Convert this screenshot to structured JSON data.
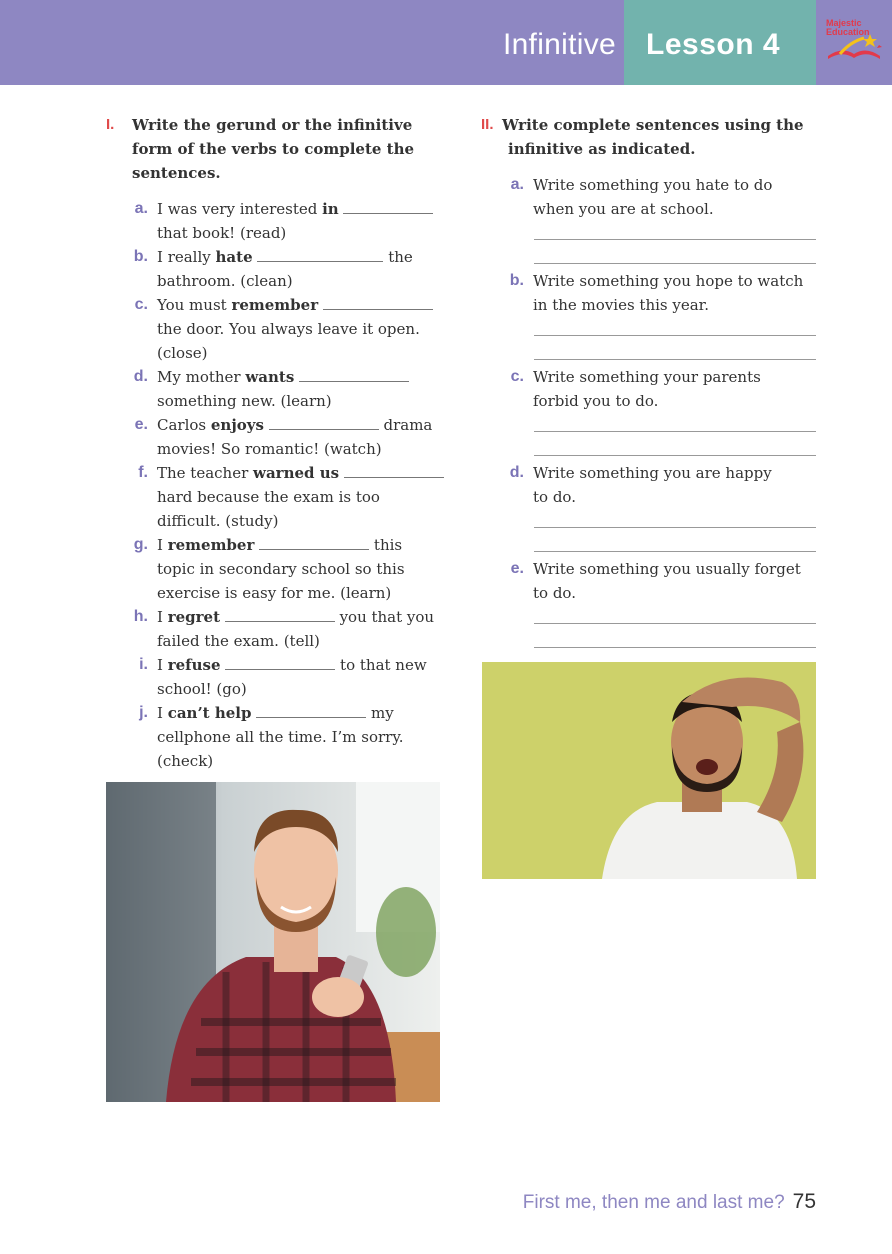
{
  "header": {
    "topic": "Infinitive",
    "lesson": "Lesson 4",
    "logo_text_1": "Majestic",
    "logo_text_2": "Education",
    "colors": {
      "band": "#8e87c2",
      "lesson_box": "#72b3ad",
      "accent_red": "#e04b4b",
      "letter": "#7b74b6"
    }
  },
  "exercise1": {
    "number": "I.",
    "title_1": "Write the gerund or the infinitive",
    "title_2": "form of the verbs to complete the",
    "title_3": "sentences.",
    "items": [
      {
        "letter": "a.",
        "pre": "I was very interested ",
        "bold": "in",
        "post": "",
        "l2": "that book! (read)"
      },
      {
        "letter": "b.",
        "pre": "I really ",
        "bold": "hate",
        "post": " the",
        "l2": "bathroom. (clean)"
      },
      {
        "letter": "c.",
        "pre": "You must ",
        "bold": "remember",
        "post": "",
        "l2": "the door. You always leave it open.",
        "l3": "(close)"
      },
      {
        "letter": "d.",
        "pre": "My mother ",
        "bold": "wants",
        "post": "",
        "l2": "something new. (learn)"
      },
      {
        "letter": "e.",
        "pre": "Carlos ",
        "bold": "enjoys",
        "post": " drama",
        "l2": "movies! So romantic! (watch)"
      },
      {
        "letter": "f.",
        "pre": "The teacher ",
        "bold": "warned us",
        "post": "",
        "l2": "hard because the exam is too",
        "l3": "difficult. (study)"
      },
      {
        "letter": "g.",
        "pre": "I ",
        "bold": "remember",
        "post": " this",
        "l2": "topic in secondary school so this",
        "l3": "exercise is easy for me. (learn)"
      },
      {
        "letter": "h.",
        "pre": "I ",
        "bold": "regret",
        "post": " you that you",
        "l2": "failed the exam. (tell)"
      },
      {
        "letter": "i.",
        "pre": "I ",
        "bold": "refuse",
        "post": " to that new",
        "l2": "school! (go)"
      },
      {
        "letter": "j.",
        "pre": "I ",
        "bold": "can’t help",
        "post": " my",
        "l2": "cellphone all the time. I’m sorry.",
        "l3": "(check)"
      }
    ]
  },
  "exercise2": {
    "number": "II.",
    "title_1": "Write complete sentences using the",
    "title_2": "infinitive as indicated.",
    "items": [
      {
        "letter": "a.",
        "l1": "Write something you hate to do",
        "l2": "when you are at school."
      },
      {
        "letter": "b.",
        "l1": "Write something you hope to watch",
        "l2": "in the movies this year."
      },
      {
        "letter": "c.",
        "l1": "Write something your parents",
        "l2": "forbid you to do."
      },
      {
        "letter": "d.",
        "l1": "Write something you are happy",
        "l2": "to do."
      },
      {
        "letter": "e.",
        "l1": "Write something you usually forget",
        "l2": "to do."
      }
    ]
  },
  "footer": {
    "tagline": "First me, then me and last me?",
    "page": "75"
  }
}
